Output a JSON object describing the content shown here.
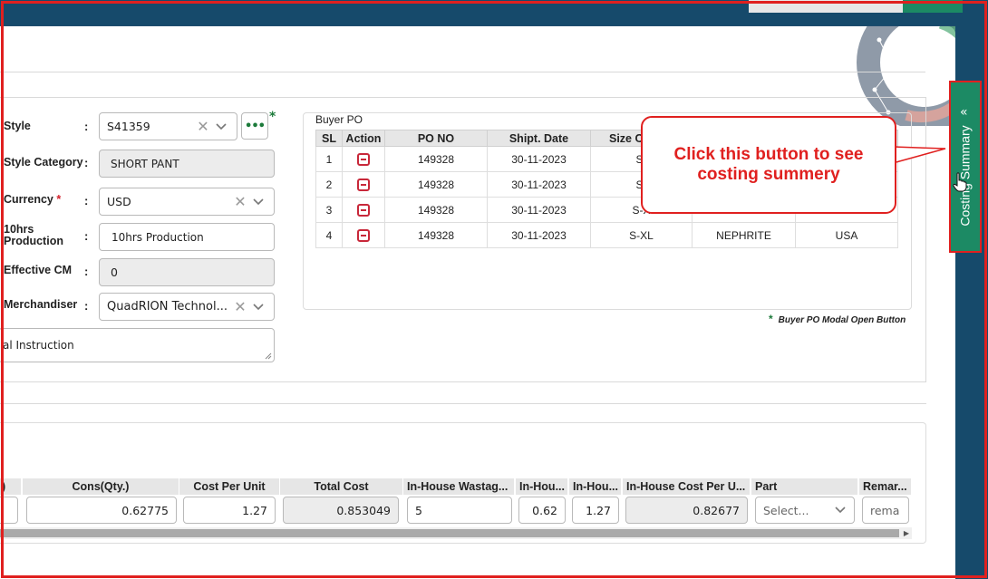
{
  "form": {
    "style": {
      "label": "Style",
      "value": "S41359"
    },
    "style_category": {
      "label": "Style Category",
      "value": "SHORT PANT"
    },
    "currency": {
      "label": "Currency",
      "required": "*",
      "value": "USD"
    },
    "production": {
      "label_line1": "10hrs",
      "label_line2": "Production",
      "value": "10hrs Production"
    },
    "effective_cm": {
      "label": "Effective CM",
      "value": "0"
    },
    "merchandiser": {
      "label": "Merchandiser",
      "value": "QuadRION Technol..."
    },
    "instruction": {
      "value": "al Instruction"
    },
    "dots_label": "•••",
    "modal_star": "*"
  },
  "buyer_po": {
    "title": "Buyer PO",
    "headers": [
      "SL",
      "Action",
      "PO NO",
      "Shipt. Date",
      "Size C",
      "",
      ""
    ],
    "rows": [
      {
        "sl": "1",
        "po": "149328",
        "date": "30-11-2023",
        "size": "S-",
        "color": "",
        "country": ""
      },
      {
        "sl": "2",
        "po": "149328",
        "date": "30-11-2023",
        "size": "S-",
        "color": "",
        "country": ""
      },
      {
        "sl": "3",
        "po": "149328",
        "date": "30-11-2023",
        "size": "S-X",
        "color": "",
        "country": ""
      },
      {
        "sl": "4",
        "po": "149328",
        "date": "30-11-2023",
        "size": "S-XL",
        "color": "NEPHRITE",
        "country": "USA"
      }
    ],
    "note_star": "*",
    "note": "Buyer PO Modal Open Button"
  },
  "callout": {
    "line1": "Click this button to see",
    "line2": "costing summery"
  },
  "side_tab": {
    "label": "Costing Summary",
    "chevron": "«"
  },
  "cost_table": {
    "headers": [
      ")",
      "Cons(Qty.)",
      "Cost Per Unit",
      "Total Cost",
      "In-House Wastag...",
      "In-Hou...",
      "In-Hou...",
      "In-House Cost Per U...",
      "Part",
      "Remar..."
    ],
    "row": {
      "cons": "0.62775",
      "cost_per_unit": "1.27",
      "total_cost": "0.853049",
      "wastage": "5",
      "inhouse1": "0.62",
      "inhouse2": "1.27",
      "inhouse_cost": "0.82677",
      "part_placeholder": "Select...",
      "remark": "rema"
    }
  },
  "colors": {
    "accent_green": "#1c8a64",
    "header_blue": "#164a6b",
    "alert_red": "#e0201f"
  }
}
